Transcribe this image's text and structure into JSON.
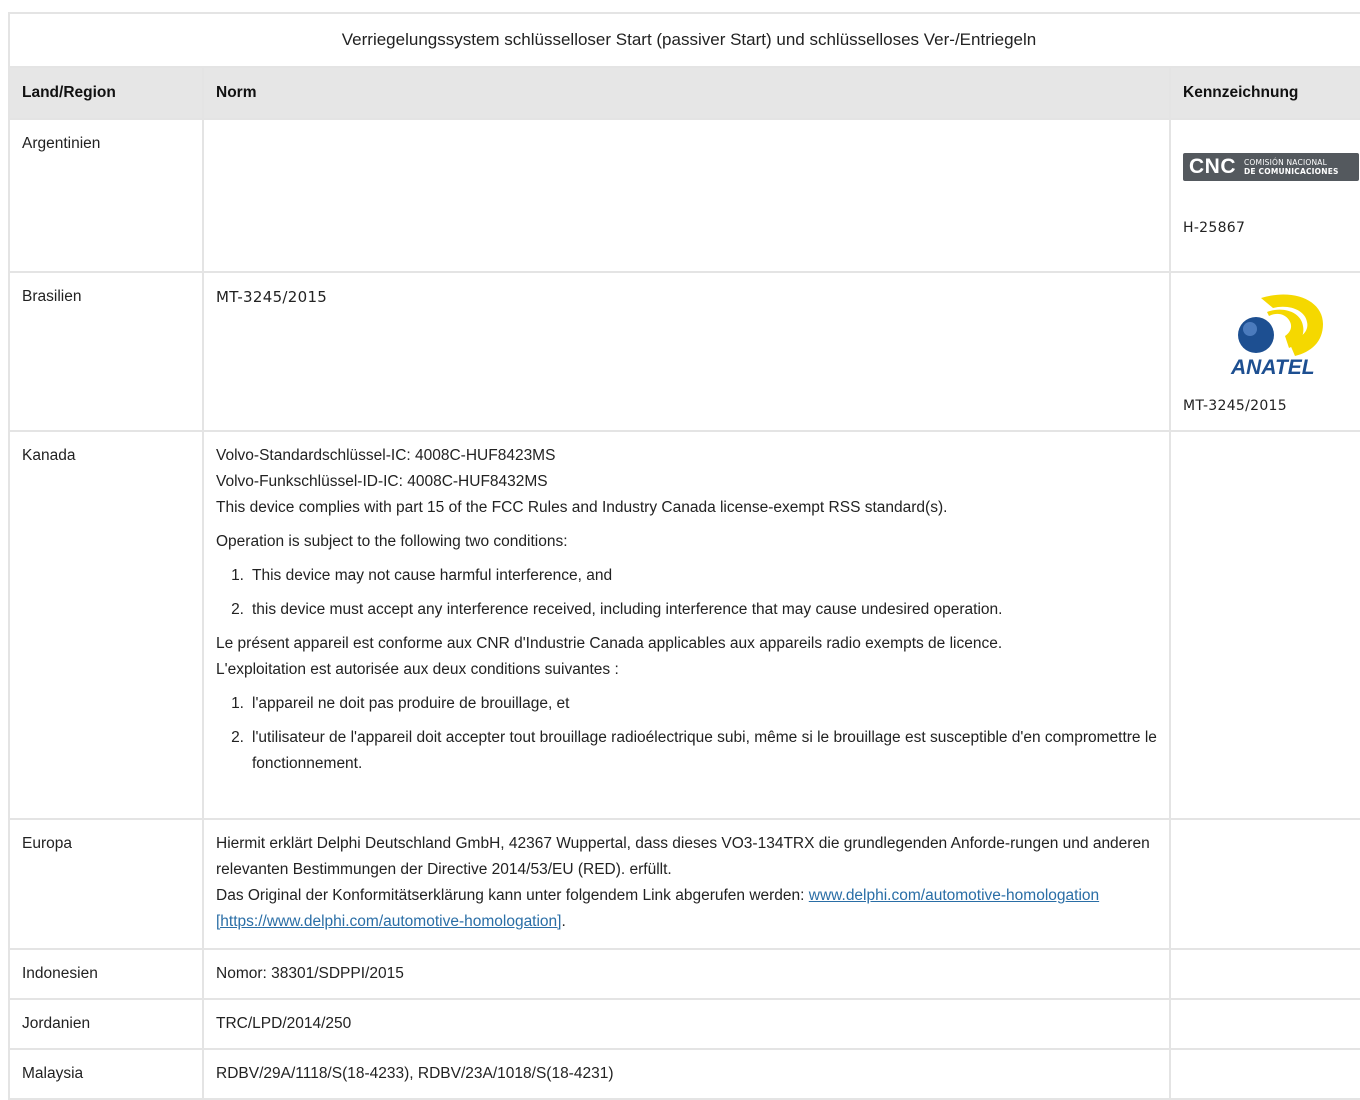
{
  "table": {
    "caption": "Verriegelungssystem schlüsselloser Start (passiver Start) und schlüsselloses Ver-/Entriegeln",
    "headers": {
      "country": "Land/Region",
      "norm": "Norm",
      "mark": "Kennzeichnung"
    },
    "argentina": {
      "country": "Argentinien",
      "logo_name": "CNC",
      "logo_sub_1": "COMISIÓN NACIONAL",
      "logo_sub_2": "DE COMUNICACIONES",
      "mark_text": "H-25867"
    },
    "brazil": {
      "country": "Brasilien",
      "norm": "MT-3245/2015",
      "logo_name": "ANATEL",
      "mark_text": "MT-3245/2015"
    },
    "canada": {
      "country": "Kanada",
      "line1": "Volvo-Standardschlüssel-IC: 4008C-HUF8423MS",
      "line2": "Volvo-Funkschlüssel-ID-IC: 4008C-HUF8432MS",
      "line3": "This device complies with part 15 of the FCC Rules and Industry Canada license-exempt RSS standard(s).",
      "line4": "Operation is subject to the following two conditions:",
      "cond1_num": "1.",
      "cond1": "This device may not cause harmful interference, and",
      "cond2_num": "2.",
      "cond2": "this device must accept any interference received, including interference that may cause undesired operation.",
      "fr1": "Le présent appareil est conforme aux CNR d'Industrie Canada applicables aux appareils radio exempts de licence.",
      "fr2": "L'exploitation est autorisée aux deux conditions suivantes :",
      "fr_cond1_num": "1.",
      "fr_cond1": "l'appareil ne doit pas produire de brouillage, et",
      "fr_cond2_num": "2.",
      "fr_cond2": "l'utilisateur de l'appareil doit accepter tout brouillage radioélectrique subi, même si le brouillage est susceptible d'en compromettre le fonctionnement."
    },
    "europe": {
      "country": "Europa",
      "line1": "Hiermit erklärt Delphi Deutschland GmbH, 42367 Wuppertal, dass dieses VO3-134TRX die grundlegenden Anforde-rungen und anderen relevanten Bestimmungen der Directive 2014/53/EU (RED). erfüllt.",
      "line2_prefix": "Das Original der Konformitätserklärung kann unter folgendem Link abgerufen werden: ",
      "link_text": "www.delphi.com/automotive-homologation [https://www.delphi.com/automotive-homologation]",
      "line2_suffix": "."
    },
    "indonesia": {
      "country": "Indonesien",
      "norm": "Nomor: 38301/SDPPI/2015"
    },
    "jordan": {
      "country": "Jordanien",
      "norm": "TRC/LPD/2014/250"
    },
    "malaysia": {
      "country": "Malaysia",
      "norm": "RDBV/29A/1118/S(18-4233), RDBV/23A/1018/S(18-4231)"
    }
  },
  "colors": {
    "border": "#e4e4e4",
    "header_bg": "#e6e6e6",
    "link": "#2a6ea6",
    "cnc_bg": "#54595e",
    "anatel_blue": "#1d4f91",
    "anatel_yellow": "#f5d800"
  }
}
